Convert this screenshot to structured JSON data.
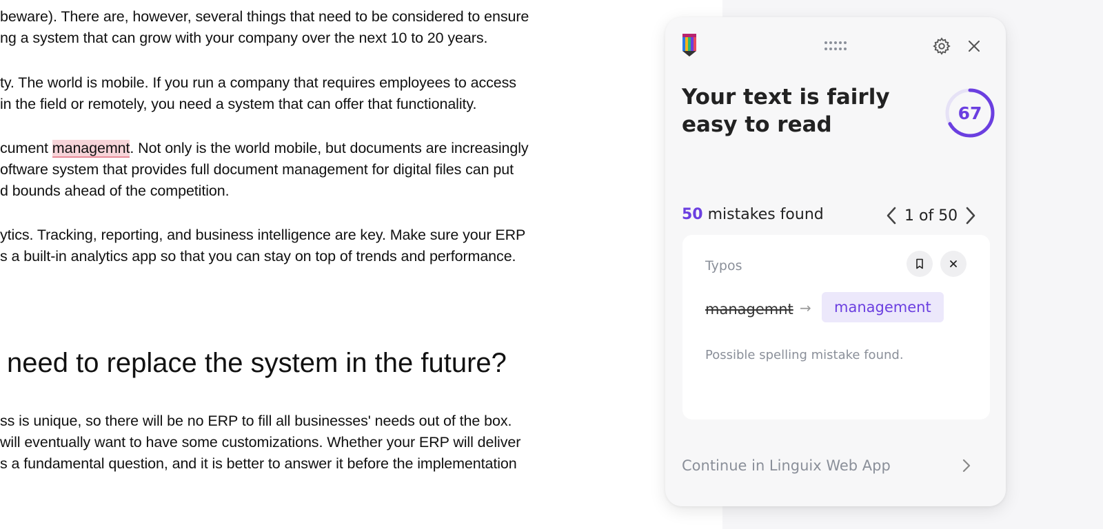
{
  "document": {
    "lines": [
      {
        "text": "beware). There are, however, several things that need to be considered to ensure"
      },
      {
        "text": "ng a system that can grow with your company over the next 10 to 20 years."
      },
      {
        "text": "ty. The world is mobile. If you run a company that requires employees to access"
      },
      {
        "text": "in the field or remotely, you need a system that can offer that functionality."
      },
      {
        "pre": "cument ",
        "mark": "managemnt",
        "post": ". Not only is the world mobile, but documents are increasingly"
      },
      {
        "text": "oftware system that provides full document management for digital files can put"
      },
      {
        "text": "d bounds ahead of the competition."
      },
      {
        "text": "ytics. Tracking, reporting, and business intelligence are key. Make sure your ERP"
      },
      {
        "text": "s a built-in analytics app so that you can stay on top of trends and performance."
      },
      {
        "text": "ss is unique, so there will be no ERP to fill all businesses' needs out of the box."
      },
      {
        "text": "will eventually want to have some customizations. Whether your ERP will deliver"
      },
      {
        "text": "s a fundamental question, and it is better to answer it before the implementation"
      }
    ],
    "heading": "need to replace the system in the future?"
  },
  "panel": {
    "icons": {
      "logo": "linguix-logo-icon",
      "drag": "drag-handle-icon",
      "settings": "gear-icon",
      "close": "close-icon"
    },
    "title": "Your text is fairly easy to read",
    "score": {
      "value": 67,
      "max": 100
    },
    "mistakes": {
      "count": "50",
      "label": "mistakes found"
    },
    "pagination": {
      "label": "1 of 50"
    },
    "card": {
      "category": "Typos",
      "original": "managemnt",
      "suggestion": "management",
      "description": "Possible spelling mistake found."
    },
    "continue_label": "Continue in Linguix Web App",
    "colors": {
      "accent": "#6b3fe0",
      "highlight": "#f7d4d9"
    }
  }
}
